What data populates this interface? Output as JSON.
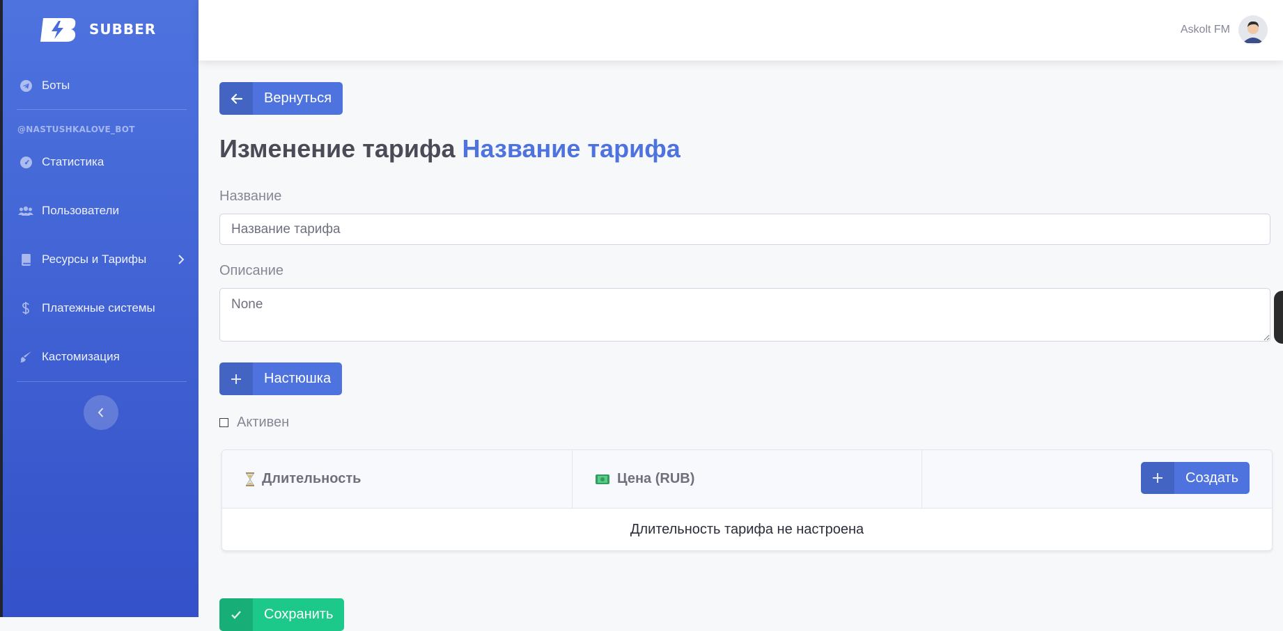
{
  "brand": {
    "name": "SUBBER"
  },
  "sidebar": {
    "bots_label": "Боты",
    "section_heading": "@NASTUSHKALOVE_BOT",
    "items": [
      {
        "label": "Статистика",
        "icon": "gauge-icon"
      },
      {
        "label": "Пользователи",
        "icon": "users-icon"
      },
      {
        "label": "Ресурсы и Тарифы",
        "icon": "book-icon",
        "has_submenu": true
      },
      {
        "label": "Платежные системы",
        "icon": "dollar-icon"
      },
      {
        "label": "Кастомизация",
        "icon": "brush-icon"
      }
    ]
  },
  "topbar": {
    "user_name": "Askolt FM"
  },
  "back_button": {
    "label": "Вернуться"
  },
  "page_title": {
    "prefix": "Изменение тарифа",
    "accent": "Название тарифа"
  },
  "form": {
    "name_label": "Название",
    "name_value": "Название тарифа",
    "description_label": "Описание",
    "description_value": "None",
    "resource_button": "Настюшка",
    "active_label": "Активен",
    "active_checked": false
  },
  "durations_table": {
    "columns": [
      "Длительность",
      "Цена (RUB)"
    ],
    "create_button": "Создать",
    "empty_text": "Длительность тарифа не настроена"
  },
  "save_button": {
    "label": "Сохранить"
  },
  "colors": {
    "primary": "#4e73df",
    "success": "#1cc88a",
    "sidebar_bottom": "#3451c9"
  }
}
